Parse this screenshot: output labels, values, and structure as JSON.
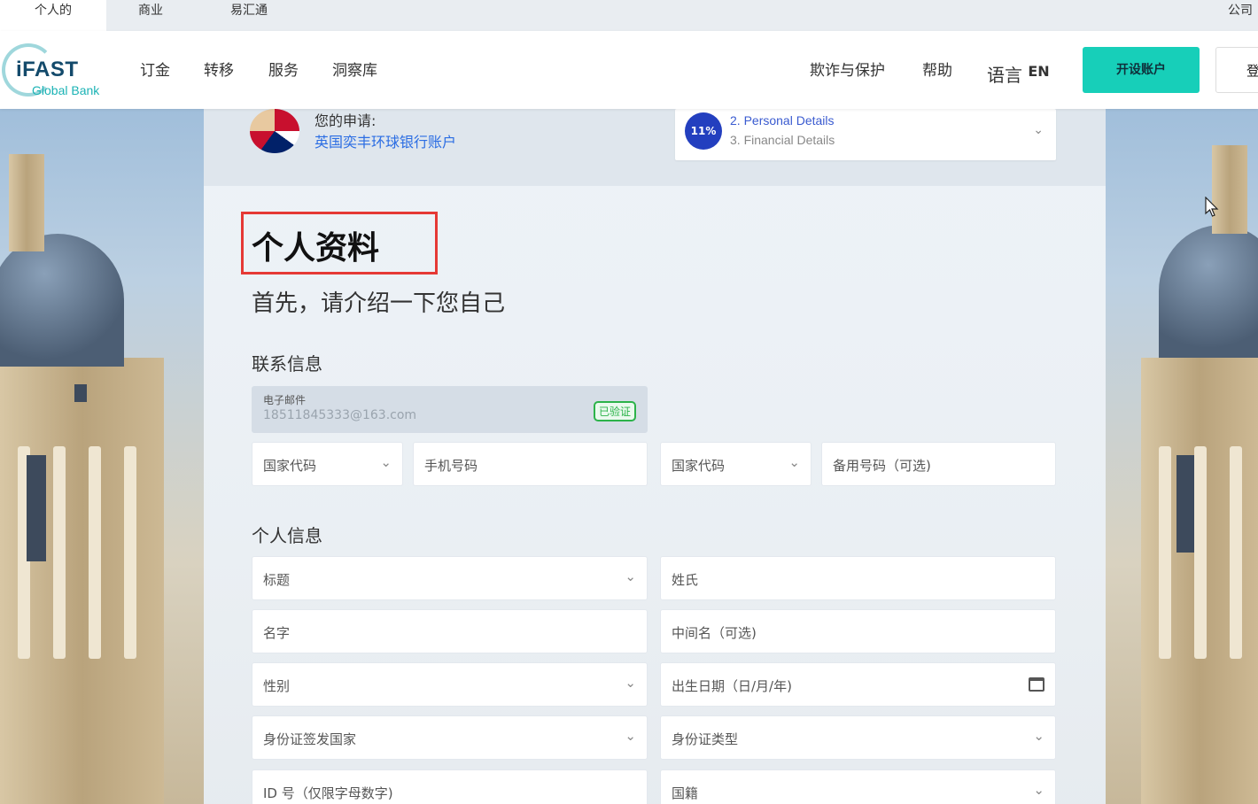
{
  "top_tabs": [
    {
      "label": "个人的",
      "active": true
    },
    {
      "label": "商业",
      "active": false
    },
    {
      "label": "易汇通",
      "active": false
    }
  ],
  "top_right": {
    "label": "公司"
  },
  "logo": {
    "text": "iFAST",
    "sub": "Global Bank"
  },
  "nav": {
    "items": [
      "订金",
      "转移",
      "服务",
      "洞察库"
    ],
    "fraud": "欺诈与保护",
    "help": "帮助",
    "language": "语言",
    "language_code": "EN",
    "open_account": "开设账户",
    "login": "登"
  },
  "application": {
    "label": "您的申请:",
    "value": "英国奕丰环球银行账户"
  },
  "progress": {
    "percent_label": "11%",
    "percent": 11,
    "current_step": "2. Personal Details",
    "next_step": "3. Financial Details"
  },
  "page": {
    "title": "个人资料",
    "subtitle": "首先，请介绍一下您自己"
  },
  "contact": {
    "heading": "联系信息",
    "email_label": "电子邮件",
    "email_value": "18511845333@163.com",
    "verified": "已验证",
    "country_code_1": "国家代码",
    "mobile": "手机号码",
    "country_code_2": "国家代码",
    "alt_phone": "备用号码（可选)"
  },
  "personal": {
    "heading": "个人信息",
    "title": "标题",
    "surname": "姓氏",
    "first_name": "名字",
    "middle_name": "中间名（可选)",
    "gender": "性别",
    "dob": "出生日期（日/月/年)",
    "id_country": "身份证签发国家",
    "id_type": "身份证类型",
    "id_number": "ID 号（仅限字母数字)",
    "nationality": "国籍"
  },
  "colors": {
    "accent": "#17cfb9",
    "progress": "#233fbf",
    "verified": "#2cb34a",
    "highlight_box": "#e53935",
    "link": "#2b6de3"
  }
}
